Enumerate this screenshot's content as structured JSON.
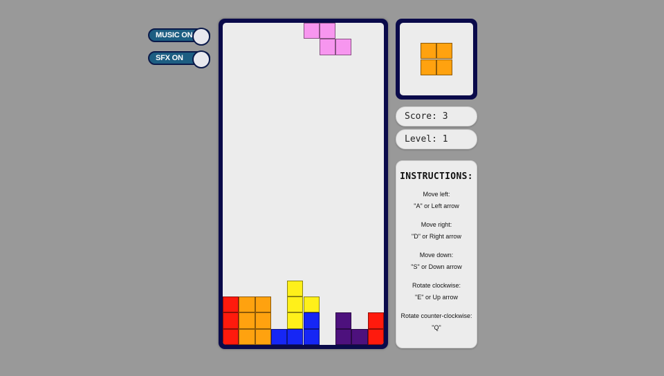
{
  "controls": {
    "music_label": "MUSIC ON",
    "sfx_label": "SFX ON"
  },
  "stats": {
    "score_label": "Score:",
    "score_value": "3",
    "level_label": "Level:",
    "level_value": "1"
  },
  "instructions": {
    "title": "INSTRUCTIONS:",
    "items": [
      {
        "action": "Move left:",
        "keys": "\"A\" or Left arrow"
      },
      {
        "action": "Move right:",
        "keys": "\"D\" or Right arrow"
      },
      {
        "action": "Move down:",
        "keys": "\"S\" or Down arrow"
      },
      {
        "action": "Rotate clockwise:",
        "keys": "\"E\" or Up arrow"
      },
      {
        "action": "Rotate counter-clockwise:",
        "keys": "\"Q\""
      }
    ]
  },
  "colors": {
    "red": "#ff1a0d",
    "orange": "#ffa20f",
    "yellow": "#fff01a",
    "blue": "#1626f5",
    "purple": "#4d117d",
    "pink": "#f796ef",
    "frame": "#0a0a4a"
  },
  "board": {
    "cols": 10,
    "rows": 20,
    "active_piece": {
      "shape": "Z",
      "color": "pink",
      "cells": [
        [
          5,
          0
        ],
        [
          6,
          0
        ],
        [
          6,
          1
        ],
        [
          7,
          1
        ]
      ]
    },
    "locked_cells": [
      {
        "c": 4,
        "r": 16,
        "color": "yellow"
      },
      {
        "c": 0,
        "r": 17,
        "color": "red"
      },
      {
        "c": 1,
        "r": 17,
        "color": "orange"
      },
      {
        "c": 2,
        "r": 17,
        "color": "orange"
      },
      {
        "c": 4,
        "r": 17,
        "color": "yellow"
      },
      {
        "c": 5,
        "r": 17,
        "color": "yellow"
      },
      {
        "c": 0,
        "r": 18,
        "color": "red"
      },
      {
        "c": 1,
        "r": 18,
        "color": "orange"
      },
      {
        "c": 2,
        "r": 18,
        "color": "orange"
      },
      {
        "c": 4,
        "r": 18,
        "color": "yellow"
      },
      {
        "c": 5,
        "r": 18,
        "color": "blue"
      },
      {
        "c": 7,
        "r": 18,
        "color": "purple"
      },
      {
        "c": 9,
        "r": 18,
        "color": "red"
      },
      {
        "c": 0,
        "r": 19,
        "color": "red"
      },
      {
        "c": 1,
        "r": 19,
        "color": "orange"
      },
      {
        "c": 2,
        "r": 19,
        "color": "orange"
      },
      {
        "c": 3,
        "r": 19,
        "color": "blue"
      },
      {
        "c": 4,
        "r": 19,
        "color": "blue"
      },
      {
        "c": 5,
        "r": 19,
        "color": "blue"
      },
      {
        "c": 7,
        "r": 19,
        "color": "purple"
      },
      {
        "c": 8,
        "r": 19,
        "color": "purple"
      },
      {
        "c": 9,
        "r": 19,
        "color": "red"
      }
    ]
  },
  "next_piece": {
    "shape": "O",
    "color": "orange",
    "cells": [
      [
        0,
        0
      ],
      [
        1,
        0
      ],
      [
        0,
        1
      ],
      [
        1,
        1
      ]
    ]
  }
}
